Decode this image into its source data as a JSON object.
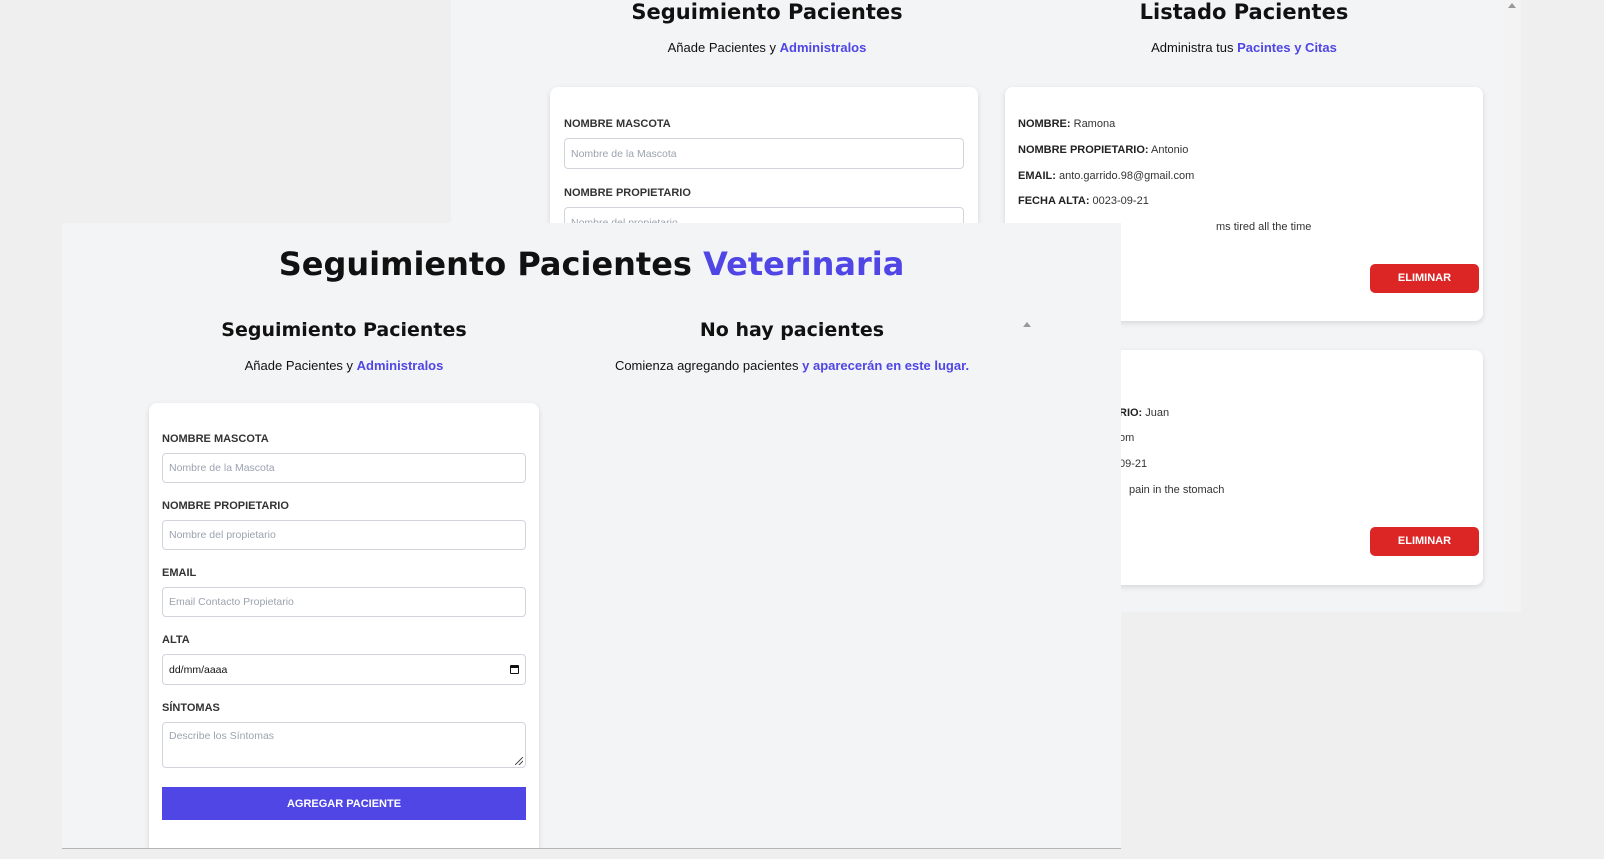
{
  "background_window": {
    "form_column": {
      "title": "Seguimiento Pacientes",
      "subtitle_prefix": "Añade Pacientes y ",
      "subtitle_accent": "Administralos",
      "fields": [
        {
          "label": "NOMBRE MASCOTA",
          "placeholder": "Nombre de la Mascota"
        },
        {
          "label": "NOMBRE PROPIETARIO",
          "placeholder": "Nombre del propietario"
        }
      ]
    },
    "list_column": {
      "title": "Listado Pacientes",
      "subtitle_prefix": "Administra tus ",
      "subtitle_accent": "Pacintes y Citas",
      "patients": [
        {
          "name_label": "NOMBRE:",
          "name": "Ramona",
          "owner_label": "NOMBRE PROPIETARIO:",
          "owner": "Antonio",
          "email_label": "EMAIL:",
          "email": "anto.garrido.98@gmail.com",
          "date_label": "FECHA ALTA:",
          "date": "0023-09-21",
          "symptoms_partial": "ms tired all the time",
          "delete_label": "ELIMINAR"
        },
        {
          "owner_partial_label": "RIO:",
          "owner": "Juan",
          "email_partial": "om",
          "date_partial": "09-21",
          "symptoms_partial": "pain in the stomach",
          "delete_label": "ELIMINAR"
        }
      ]
    }
  },
  "foreground_window": {
    "title_main": "Seguimiento Pacientes ",
    "title_accent": "Veterinaria",
    "form_column": {
      "title": "Seguimiento Pacientes",
      "subtitle_prefix": "Añade Pacientes y ",
      "subtitle_accent": "Administralos"
    },
    "form": {
      "pet_name": {
        "label": "NOMBRE MASCOTA",
        "placeholder": "Nombre de la Mascota"
      },
      "owner_name": {
        "label": "NOMBRE PROPIETARIO",
        "placeholder": "Nombre del propietario"
      },
      "email": {
        "label": "EMAIL",
        "placeholder": "Email Contacto Propietario"
      },
      "date": {
        "label": "ALTA",
        "value": "dd/mm/aaaa"
      },
      "symptoms": {
        "label": "SÍNTOMAS",
        "placeholder": "Describe los Síntomas"
      },
      "submit_label": "AGREGAR PACIENTE"
    },
    "empty_state": {
      "title": "No hay pacientes",
      "subtitle_prefix": "Comienza agregando pacientes ",
      "subtitle_accent": "y aparecerán en este lugar."
    }
  },
  "colors": {
    "accent": "#4f46e5",
    "delete": "#dc2626",
    "page_bg": "#f3f4f6"
  }
}
